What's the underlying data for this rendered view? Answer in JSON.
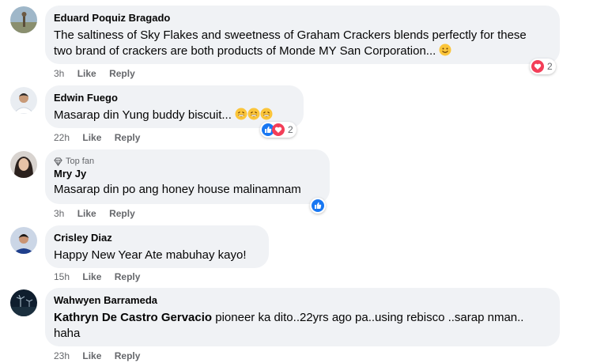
{
  "comments": [
    {
      "name": "Eduard Poquiz Bragado",
      "text_line1": "The saltiness of Sky Flakes and sweetness of Graham Crackers blends perfectly for these",
      "text_line2": "two brand of crackers are both products of Monde MY San Corporation...",
      "time": "3h",
      "like": "Like",
      "reply": "Reply",
      "reaction_count": "2",
      "reaction_icons": [
        "love-icon"
      ]
    },
    {
      "name": "Edwin Fuego",
      "text": "Masarap din Yung buddy biscuit...",
      "time": "22h",
      "like": "Like",
      "reply": "Reply",
      "reaction_count": "2",
      "reaction_icons": [
        "like-icon",
        "love-icon"
      ]
    },
    {
      "badge": "Top fan",
      "name": "Mry Jy",
      "text": "Masarap din po ang honey house malinamnam",
      "time": "3h",
      "like": "Like",
      "reply": "Reply",
      "reaction_icons": [
        "like-icon"
      ]
    },
    {
      "name": "Crisley Diaz",
      "text": "Happy New Year Ate mabuhay kayo!",
      "time": "15h",
      "like": "Like",
      "reply": "Reply"
    },
    {
      "name": "Wahwyen Barrameda",
      "mention": "Kathryn De Castro Gervacio",
      "text_line1": " pioneer ka dito..22yrs ago pa..using rebisco ..sarap nman..",
      "text_line2": "haha",
      "time": "23h",
      "like": "Like",
      "reply": "Reply"
    }
  ],
  "colors": {
    "bubble": "#f0f2f5",
    "meta_text": "#65676b",
    "like_blue": "#1877f2",
    "love_red": "#f33e58"
  }
}
